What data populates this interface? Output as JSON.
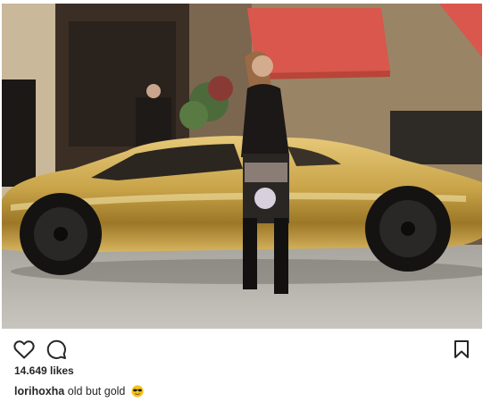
{
  "post": {
    "likes_text": "14.649 likes",
    "caption": {
      "username": "lorihoxha",
      "text": "old but gold"
    }
  },
  "icons": {
    "like": "heart-icon",
    "comment": "comment-bubble-icon",
    "save": "bookmark-icon",
    "caption_emoji": "sunglasses-emoji-icon"
  },
  "colors": {
    "text": "#262626",
    "car_gold": "#c9a449",
    "awning_red": "#d9574c",
    "emoji_yellow": "#f4c21a"
  }
}
